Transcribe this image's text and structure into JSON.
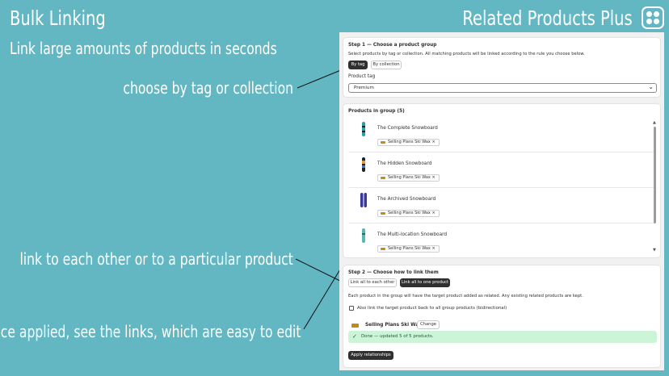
{
  "slide": {
    "title": "Bulk Linking",
    "app_name": "Related Products Plus",
    "tagline": "Link large amounts of products in seconds",
    "annotations": [
      "choose by tag or collection",
      "link to each other or to a particular product",
      "once applied, see the links, which are easy to edit"
    ]
  },
  "step1": {
    "heading": "Step 1 — Choose a product group",
    "description": "Select products by tag or collection. All matching products will be linked according to the rule you choose below.",
    "by_tag": "By tag",
    "by_collection": "By collection",
    "field_label": "Product tag",
    "selected_tag": "Premium"
  },
  "group": {
    "heading": "Products in group (5)",
    "products": [
      {
        "name": "The Complete Snowboard",
        "link": "Selling Plans Ski Wax"
      },
      {
        "name": "The Hidden Snowboard",
        "link": "Selling Plans Ski Wax"
      },
      {
        "name": "The Archived Snowboard",
        "link": "Selling Plans Ski Wax"
      },
      {
        "name": "The Multi-location Snowboard",
        "link": "Selling Plans Ski Wax"
      }
    ],
    "remove_glyph": "×"
  },
  "step2": {
    "heading": "Step 2 — Choose how to link them",
    "link_each_other": "Link all to each other",
    "link_one": "Link all to one product",
    "description": "Each product in the group will have the target product added as related. Any existing related products are kept.",
    "bidirectional_label": "Also link the target product back to all group products (bidirectional)",
    "target_product": "Selling Plans Ski Wax",
    "change": "Change",
    "status": "Done — updated 5 of 5 products.",
    "apply": "Apply relationships"
  },
  "colors": {
    "background": "#62b7c3",
    "primary_button": "#303030",
    "success_banner": "#ccf5d8"
  },
  "icons": [
    "app-logo-icon",
    "chevron-down-icon",
    "snowboard-icon",
    "ski-wax-icon",
    "close-icon",
    "checkmark-icon"
  ]
}
